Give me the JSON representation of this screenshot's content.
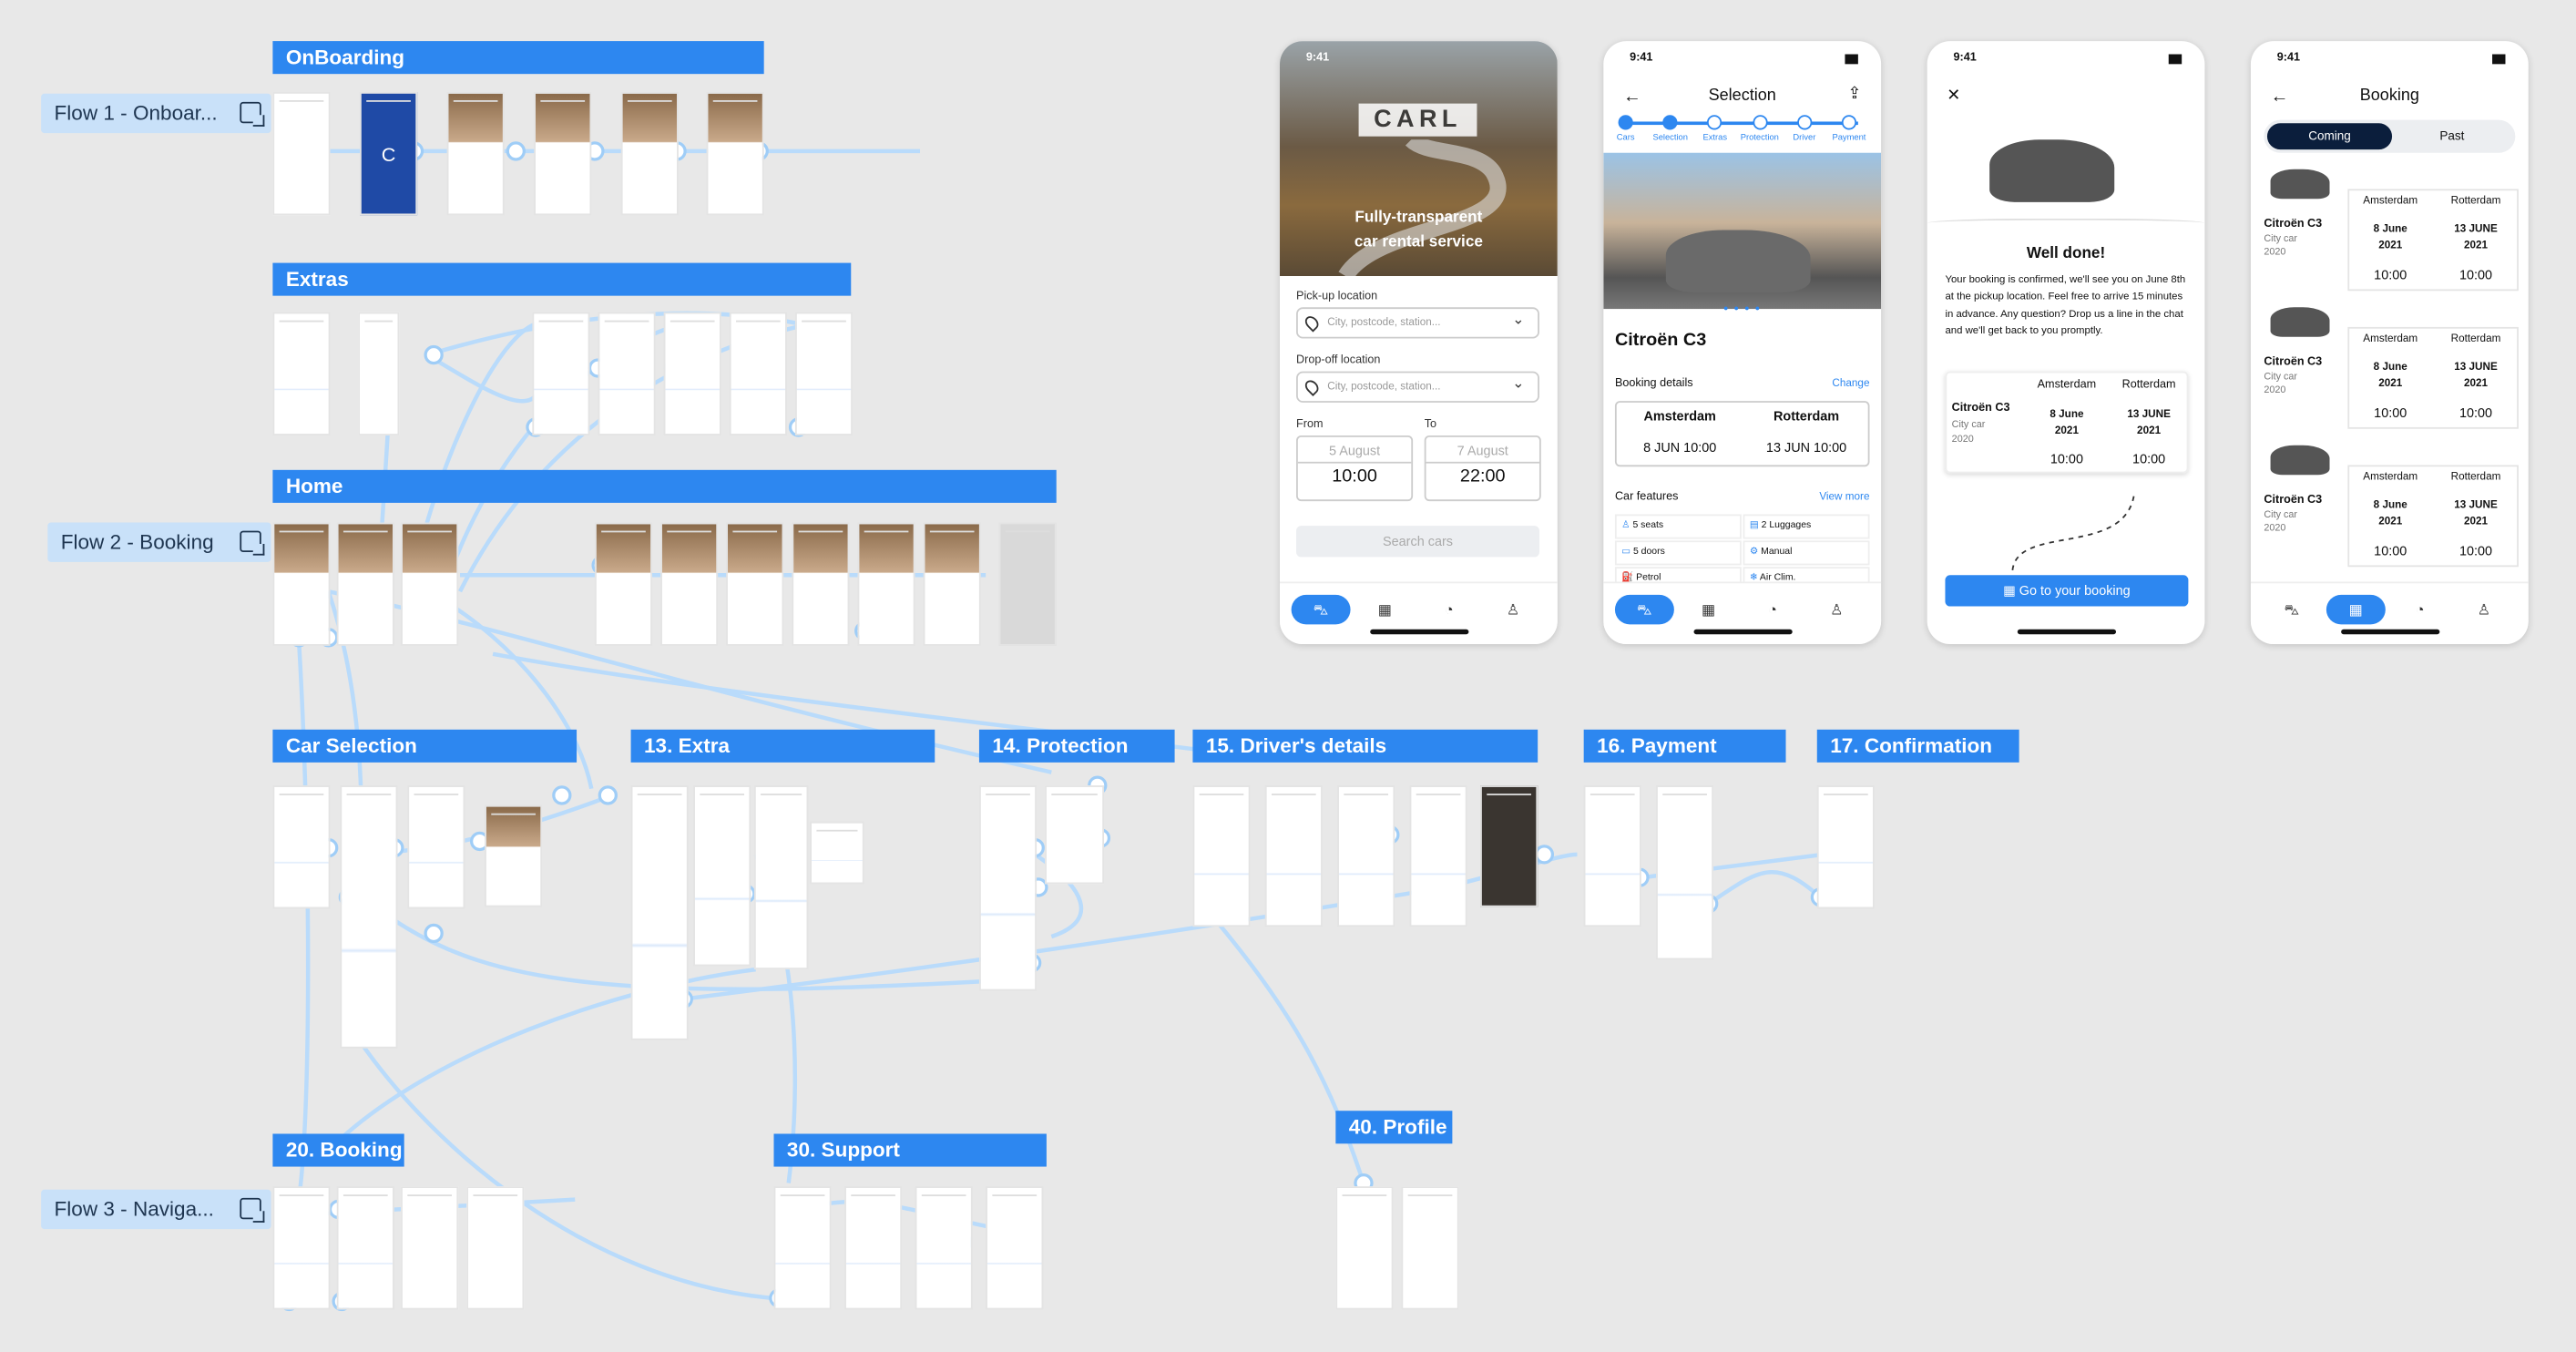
{
  "flows": [
    {
      "label": "Flow 1 - Onboar...",
      "icon": "flow-link-icon"
    },
    {
      "label": "Flow 2 - Booking",
      "icon": "flow-link-icon"
    },
    {
      "label": "Flow 3 - Naviga...",
      "icon": "flow-link-icon"
    }
  ],
  "sections": {
    "onboarding": "OnBoarding",
    "extras": "Extras",
    "home": "Home",
    "car_selection": "Car Selection",
    "extra": "13. Extra",
    "protection": "14. Protection",
    "drivers": "15. Driver's details",
    "payment": "16. Payment",
    "confirmation": "17. Confirmation",
    "booking": "20. Booking",
    "support": "30. Support",
    "profile": "40. Profile"
  },
  "status_time": "9:41",
  "thumb_text": {
    "onboarding_logo": "C"
  },
  "home_screen": {
    "brand": "CARL",
    "tagline_1": "Fully-transparent",
    "tagline_2": "car rental service",
    "pickup_label": "Pick-up location",
    "pickup_placeholder": "City, postcode, station...",
    "dropoff_label": "Drop-off location",
    "dropoff_placeholder": "City, postcode, station...",
    "from_label": "From",
    "to_label": "To",
    "from_date": "5 August",
    "from_time": "10:00",
    "to_date": "7 August",
    "to_time": "22:00",
    "search_button": "Search cars"
  },
  "selection_screen": {
    "title": "Selection",
    "steps": [
      "Cars",
      "Selection",
      "Extras",
      "Protection",
      "Driver",
      "Payment"
    ],
    "car_name": "Citroën C3",
    "booking_details_label": "Booking details",
    "change_label": "Change",
    "from_city": "Amsterdam",
    "to_city": "Rotterdam",
    "from_datetime": "8 JUN 10:00",
    "to_datetime": "13 JUN 10:00",
    "features_label": "Car features",
    "view_more": "View more",
    "features": [
      "5 seats",
      "2 Luggages",
      "5 doors",
      "Manual",
      "Petrol",
      "Air Clim."
    ]
  },
  "confirm_screen": {
    "heading": "Well done!",
    "message": "Your booking is confirmed, we'll see you on June 8th at the pickup location. Feel free to arrive 15 minutes in advance. Any question? Drop us a line in the chat and we'll get back to you promptly.",
    "car_name": "Citroën C3",
    "car_type": "City car",
    "car_year": "2020",
    "from_city": "Amsterdam",
    "to_city": "Rotterdam",
    "from_date": "8 June",
    "from_year": "2021",
    "to_date": "13 JUNE",
    "to_year": "2021",
    "from_time": "10:00",
    "to_time": "10:00",
    "button": "Go to your booking"
  },
  "booking_screen": {
    "title": "Booking",
    "tabs": [
      "Coming",
      "Past"
    ],
    "item": {
      "car_name": "Citroën C3",
      "car_type": "City car",
      "car_year": "2020",
      "from_city": "Amsterdam",
      "to_city": "Rotterdam",
      "from_date": "8 June",
      "from_year": "2021",
      "to_date": "13 JUNE",
      "to_year": "2021",
      "from_time": "10:00",
      "to_time": "10:00"
    }
  },
  "colors": {
    "accent": "#2d87f0",
    "flow_chip": "#c9e1f9",
    "wire": "#b9dbfb",
    "canvas": "#e8e8e8"
  }
}
